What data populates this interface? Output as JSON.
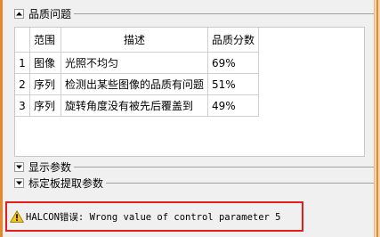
{
  "sections": {
    "quality": {
      "label": "品质问题",
      "expanded": true
    },
    "display": {
      "label": "显示参数",
      "expanded": false
    },
    "calib": {
      "label": "标定板提取参数",
      "expanded": false
    }
  },
  "table": {
    "headers": {
      "num": "",
      "scope": "范围",
      "desc": "描述",
      "score": "品质分数"
    },
    "rows": [
      {
        "num": "1",
        "scope": "图像",
        "desc": "光照不均匀",
        "score": "69%"
      },
      {
        "num": "2",
        "scope": "序列",
        "desc": "检测出某些图像的品质有问题",
        "score": "51%"
      },
      {
        "num": "3",
        "scope": "序列",
        "desc": "旋转角度没有被先后覆盖到",
        "score": "49%"
      }
    ]
  },
  "error": {
    "text": "HALCON错误: Wrong value of control parameter 5",
    "icon": "warning-triangle-icon",
    "border_color": "#e21e1e"
  },
  "colors": {
    "window_accent": "#e8872c",
    "highlight_box": "#e21e1e"
  }
}
